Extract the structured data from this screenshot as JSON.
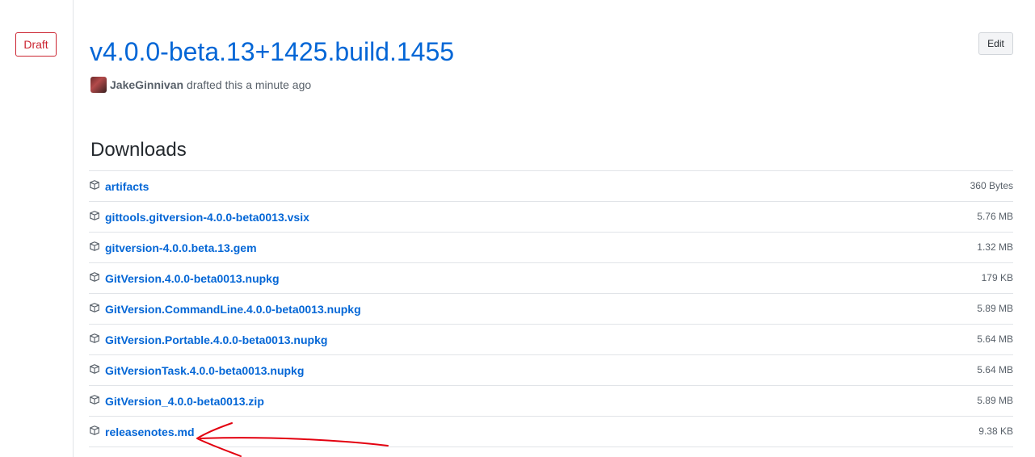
{
  "release": {
    "draft_label": "Draft",
    "title": "v4.0.0-beta.13+1425.build.1455",
    "author": "JakeGinnivan",
    "status_text": "drafted this a minute ago",
    "edit_label": "Edit"
  },
  "downloads": {
    "heading": "Downloads",
    "assets": [
      {
        "name": "artifacts",
        "size": "360 Bytes",
        "icon": "package-icon"
      },
      {
        "name": "gittools.gitversion-4.0.0-beta0013.vsix",
        "size": "5.76 MB",
        "icon": "package-icon"
      },
      {
        "name": "gitversion-4.0.0.beta.13.gem",
        "size": "1.32 MB",
        "icon": "package-icon"
      },
      {
        "name": "GitVersion.4.0.0-beta0013.nupkg",
        "size": "179 KB",
        "icon": "package-icon"
      },
      {
        "name": "GitVersion.CommandLine.4.0.0-beta0013.nupkg",
        "size": "5.89 MB",
        "icon": "package-icon"
      },
      {
        "name": "GitVersion.Portable.4.0.0-beta0013.nupkg",
        "size": "5.64 MB",
        "icon": "package-icon"
      },
      {
        "name": "GitVersionTask.4.0.0-beta0013.nupkg",
        "size": "5.64 MB",
        "icon": "package-icon"
      },
      {
        "name": "GitVersion_4.0.0-beta0013.zip",
        "size": "5.89 MB",
        "icon": "package-icon"
      },
      {
        "name": "releasenotes.md",
        "size": "9.38 KB",
        "icon": "package-icon"
      }
    ]
  },
  "colors": {
    "link": "#0366d6",
    "draft": "#cb2431",
    "annotation_arrow": "#e3000f"
  }
}
